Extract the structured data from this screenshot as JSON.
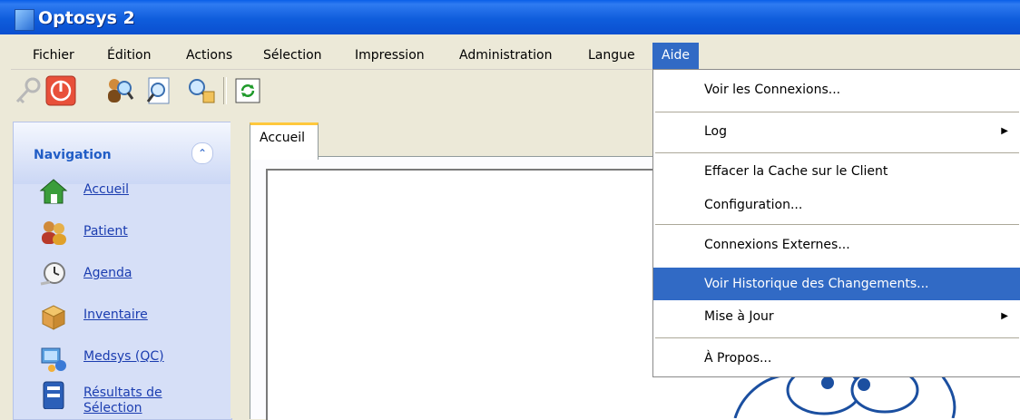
{
  "window": {
    "title": "Optosys 2",
    "icon": "app-window-icon"
  },
  "menubar": {
    "items": [
      {
        "label": "Fichier"
      },
      {
        "label": "Édition"
      },
      {
        "label": "Actions"
      },
      {
        "label": "Sélection"
      },
      {
        "label": "Impression"
      },
      {
        "label": "Administration"
      },
      {
        "label": "Langue"
      },
      {
        "label": "Aide",
        "active": true
      }
    ]
  },
  "toolbar": {
    "buttons": [
      {
        "icon": "key-icon",
        "enabled": false
      },
      {
        "icon": "power-icon"
      },
      {
        "icon": "search-person-icon"
      },
      {
        "icon": "search-document-icon"
      },
      {
        "icon": "search-people-icon"
      },
      {
        "icon": "refresh-icon"
      }
    ]
  },
  "navigation": {
    "title": "Navigation",
    "collapse_icon": "chevron-double-up-icon",
    "items": [
      {
        "label": "Accueil",
        "icon": "home-icon"
      },
      {
        "label": "Patient",
        "icon": "patients-icon"
      },
      {
        "label": "Agenda",
        "icon": "clock-icon"
      },
      {
        "label": "Inventaire",
        "icon": "box-icon"
      },
      {
        "label": "Medsys (QC)",
        "icon": "medsys-icon"
      },
      {
        "label": "Résultats de",
        "label2": "Sélection",
        "icon": "results-icon"
      }
    ]
  },
  "tabs": [
    {
      "label": "Accueil",
      "active": true
    }
  ],
  "aide_menu": {
    "items": [
      {
        "label": "Voir les Connexions..."
      },
      {
        "label": "Log",
        "submenu": true
      },
      {
        "label": "Effacer la Cache sur le Client"
      },
      {
        "label": "Configuration..."
      },
      {
        "label": "Connexions Externes..."
      },
      {
        "label": "Voir Historique des Changements...",
        "highlighted": true
      },
      {
        "label": "Mise à Jour",
        "submenu": true
      },
      {
        "label": "À Propos..."
      }
    ],
    "submenu_arrow": "▶",
    "highlight_color": "#316ac5"
  },
  "colors": {
    "titlebar": "#0a4fd0",
    "menu_highlight": "#316ac5",
    "nav_link": "#1b3db0",
    "nav_header_text": "#215dc6",
    "tab_accent": "#ffc83c"
  }
}
